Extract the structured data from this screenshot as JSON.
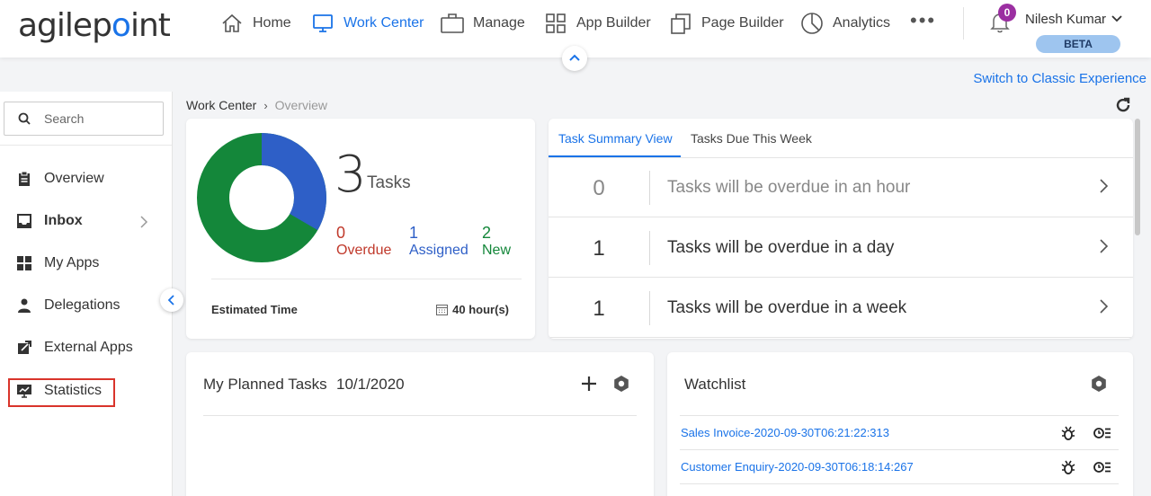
{
  "brand": {
    "logo_text_a": "agilep",
    "logo_text_b": "int"
  },
  "nav": {
    "items": [
      {
        "label": "Home"
      },
      {
        "label": "Work Center"
      },
      {
        "label": "Manage"
      },
      {
        "label": "App Builder"
      },
      {
        "label": "Page Builder"
      },
      {
        "label": "Analytics"
      }
    ],
    "more": "•••",
    "active_color": "#1a73e8"
  },
  "user": {
    "name": "Nilesh Kumar",
    "notification_count": "0",
    "badge": "BETA"
  },
  "classic_link": "Switch to Classic Experience",
  "sidebar": {
    "search_placeholder": "Search",
    "items": [
      {
        "label": "Overview",
        "icon": "clipboard-icon"
      },
      {
        "label": "Inbox",
        "icon": "inbox-icon"
      },
      {
        "label": "My Apps",
        "icon": "grid-icon"
      },
      {
        "label": "Delegations",
        "icon": "person-icon"
      },
      {
        "label": "External Apps",
        "icon": "external-link-icon"
      },
      {
        "label": "Statistics",
        "icon": "chart-icon"
      }
    ]
  },
  "breadcrumb": {
    "parent": "Work Center",
    "current": "Overview"
  },
  "tasks": {
    "total": "3",
    "label": "Tasks",
    "overdue": {
      "value": "0",
      "label": "Overdue",
      "color": "#c0392b"
    },
    "assigned": {
      "value": "1",
      "label": "Assigned",
      "color": "#2e5fc7"
    },
    "new": {
      "value": "2",
      "label": "New",
      "color": "#14873a"
    },
    "estimated_label": "Estimated Time",
    "estimated_value": "40 hour(s)"
  },
  "summary": {
    "tabs": [
      {
        "label": "Task Summary View"
      },
      {
        "label": "Tasks Due This Week"
      }
    ],
    "rows": [
      {
        "count": "0",
        "label": "Tasks will be overdue in an hour"
      },
      {
        "count": "1",
        "label": "Tasks will be overdue in a day"
      },
      {
        "count": "1",
        "label": "Tasks will be overdue in a week"
      }
    ]
  },
  "planned": {
    "title": "My Planned Tasks",
    "date": "10/1/2020"
  },
  "watchlist": {
    "title": "Watchlist",
    "items": [
      {
        "label": "Sales Invoice-2020-09-30T06:21:22:313"
      },
      {
        "label": "Customer Enquiry-2020-09-30T06:18:14:267"
      }
    ]
  }
}
